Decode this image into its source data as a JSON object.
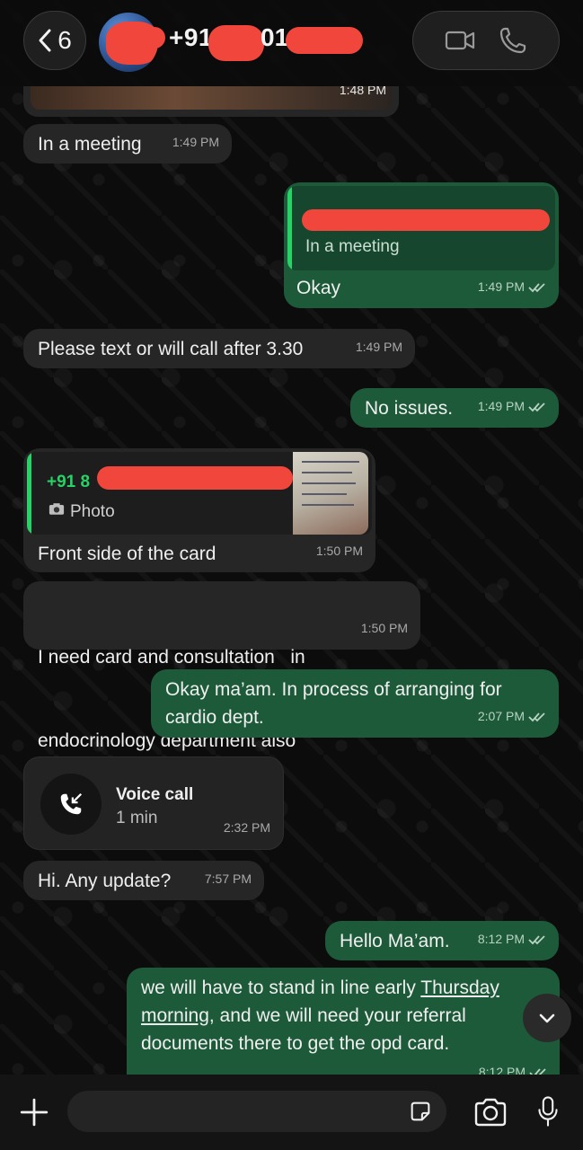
{
  "header": {
    "back_count": "6",
    "contact_name": "+91"
  },
  "messages": {
    "photo_time": "1:48 PM",
    "m1": {
      "text": "In a meeting",
      "time": "1:49 PM"
    },
    "m2": {
      "quote_text": "In a meeting",
      "text": "Okay",
      "time": "1:49 PM"
    },
    "m3": {
      "text": "Please text or will call after 3.30",
      "time": "1:49 PM"
    },
    "m4": {
      "text": "No issues.",
      "time": "1:49 PM"
    },
    "m5": {
      "quote_name": "+91 8",
      "quote_type": "Photo",
      "text": "Front side of the card",
      "time": "1:50 PM"
    },
    "m6": {
      "line1": "I need card and consultation   in",
      "line2": "endocrinology department also",
      "time": "1:50 PM"
    },
    "m7": {
      "line1": "Okay ma’am. In process of arranging for",
      "line2": "cardio dept.",
      "time": "2:07 PM"
    },
    "m8": {
      "title": "Voice call",
      "duration": "1 min",
      "time": "2:32 PM"
    },
    "m9": {
      "text": "Hi. Any update?",
      "time": "7:57 PM"
    },
    "m10": {
      "text": "Hello Ma’am.",
      "time": "8:12 PM"
    },
    "m11": {
      "part1": "we will have to stand in line early ",
      "link1": "Thursday",
      "link2": "morning",
      "part2": ", and we will need your referral",
      "line3": "documents there to get the opd card.",
      "time": "8:12 PM"
    }
  },
  "colors": {
    "incoming": "#262626",
    "outgoing": "#1d5a3a",
    "accent_green": "#25d366",
    "redaction": "#f1463b"
  },
  "icons": [
    "chevron-left-icon",
    "video-camera-icon",
    "phone-icon",
    "camera-icon",
    "incoming-call-icon",
    "chevron-down-icon",
    "plus-icon",
    "sticker-icon",
    "microphone-icon"
  ]
}
